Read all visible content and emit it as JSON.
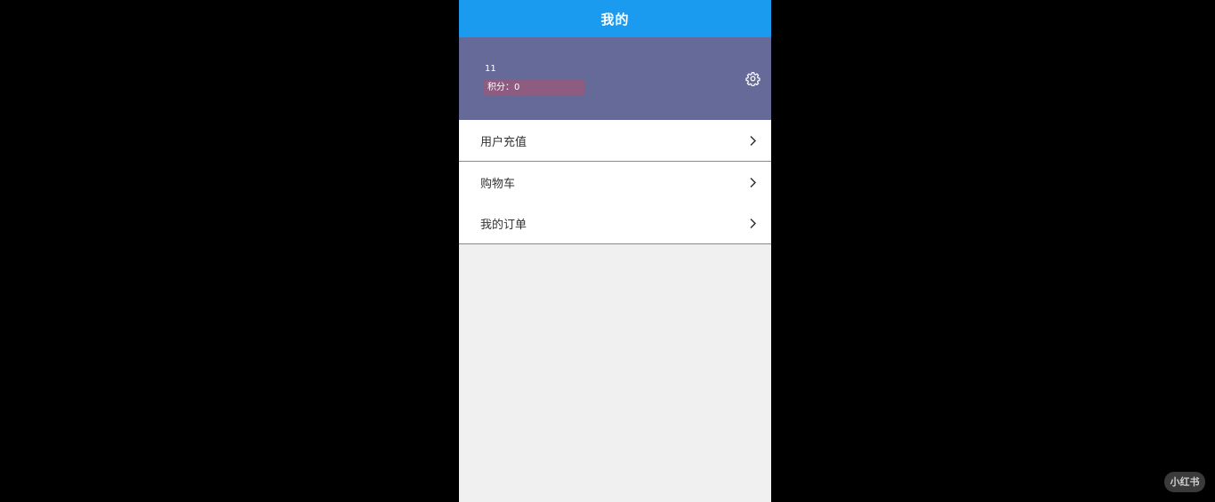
{
  "navbar": {
    "title": "我的"
  },
  "profile": {
    "username": "11",
    "points_text": "积分：0",
    "settings_icon": "gear-icon"
  },
  "menu": {
    "items": [
      {
        "label": "用户充值",
        "icon": "chevron-right-icon"
      },
      {
        "label": "购物车",
        "icon": "chevron-right-icon"
      },
      {
        "label": "我的订单",
        "icon": "chevron-right-icon"
      }
    ]
  },
  "watermark": {
    "text": "小红书"
  },
  "colors": {
    "navbar": "#1a9bf0",
    "profile_bg": "#666a99",
    "points_badge": "#8e5c80",
    "page_bg": "#f0f0f0"
  }
}
